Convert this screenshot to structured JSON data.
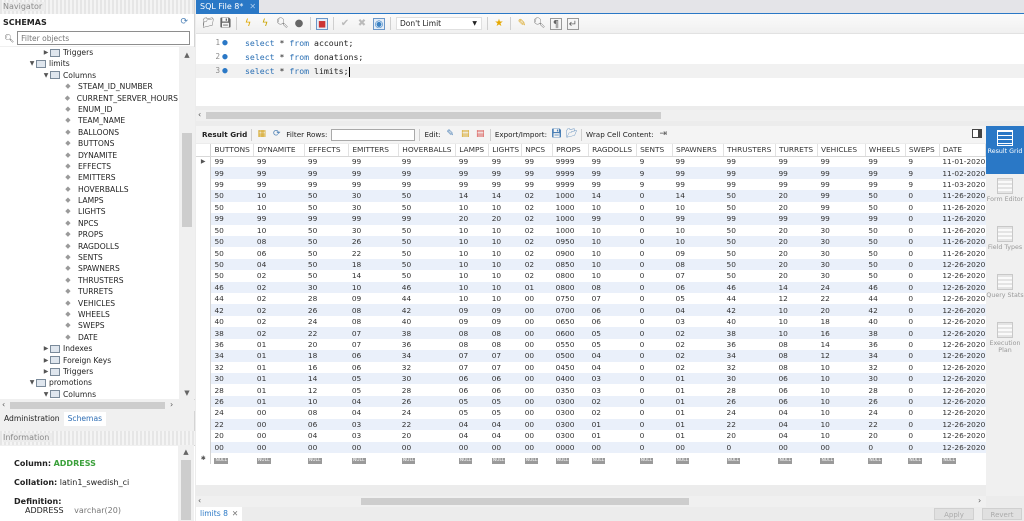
{
  "navigator": {
    "header": "Navigator",
    "schemas_title": "SCHEMAS",
    "filter_placeholder": "Filter objects",
    "tree": [
      {
        "label": "Triggers",
        "level": 3,
        "type": "folder",
        "toggle": "collapsed"
      },
      {
        "label": "limits",
        "level": 2,
        "type": "table",
        "toggle": "expanded"
      },
      {
        "label": "Columns",
        "level": 3,
        "type": "folder",
        "toggle": "expanded"
      },
      {
        "label": "STEAM_ID_NUMBER",
        "level": 4,
        "type": "column"
      },
      {
        "label": "CURRENT_SERVER_HOURS",
        "level": 4,
        "type": "column"
      },
      {
        "label": "ENUM_ID",
        "level": 4,
        "type": "column"
      },
      {
        "label": "TEAM_NAME",
        "level": 4,
        "type": "column"
      },
      {
        "label": "BALLOONS",
        "level": 4,
        "type": "column"
      },
      {
        "label": "BUTTONS",
        "level": 4,
        "type": "column"
      },
      {
        "label": "DYNAMITE",
        "level": 4,
        "type": "column"
      },
      {
        "label": "EFFECTS",
        "level": 4,
        "type": "column"
      },
      {
        "label": "EMITTERS",
        "level": 4,
        "type": "column"
      },
      {
        "label": "HOVERBALLS",
        "level": 4,
        "type": "column"
      },
      {
        "label": "LAMPS",
        "level": 4,
        "type": "column"
      },
      {
        "label": "LIGHTS",
        "level": 4,
        "type": "column"
      },
      {
        "label": "NPCS",
        "level": 4,
        "type": "column"
      },
      {
        "label": "PROPS",
        "level": 4,
        "type": "column"
      },
      {
        "label": "RAGDOLLS",
        "level": 4,
        "type": "column"
      },
      {
        "label": "SENTS",
        "level": 4,
        "type": "column"
      },
      {
        "label": "SPAWNERS",
        "level": 4,
        "type": "column"
      },
      {
        "label": "THRUSTERS",
        "level": 4,
        "type": "column"
      },
      {
        "label": "TURRETS",
        "level": 4,
        "type": "column"
      },
      {
        "label": "VEHICLES",
        "level": 4,
        "type": "column"
      },
      {
        "label": "WHEELS",
        "level": 4,
        "type": "column"
      },
      {
        "label": "SWEPS",
        "level": 4,
        "type": "column"
      },
      {
        "label": "DATE",
        "level": 4,
        "type": "column"
      },
      {
        "label": "Indexes",
        "level": 3,
        "type": "folder",
        "toggle": "collapsed"
      },
      {
        "label": "Foreign Keys",
        "level": 3,
        "type": "folder",
        "toggle": "collapsed"
      },
      {
        "label": "Triggers",
        "level": 3,
        "type": "folder",
        "toggle": "collapsed"
      },
      {
        "label": "promotions",
        "level": 2,
        "type": "table",
        "toggle": "expanded"
      },
      {
        "label": "Columns",
        "level": 3,
        "type": "folder",
        "toggle": "expanded"
      }
    ],
    "tabs": [
      "Administration",
      "Schemas"
    ],
    "active_tab": "Schemas"
  },
  "information": {
    "header": "Information",
    "column_label": "Column:",
    "column_value": "ADDRESS",
    "collation_label": "Collation:",
    "collation_value": "latin1_swedish_ci",
    "definition_label": "Definition:",
    "definition_name": "ADDRESS",
    "definition_type": "varchar(20)"
  },
  "editor": {
    "tab_title": "SQL File 8*",
    "limit_select": "Don't Limit",
    "lines": [
      {
        "num": "1",
        "kw1": "select",
        "mid": " * ",
        "kw2": "from",
        "rest": " account;"
      },
      {
        "num": "2",
        "kw1": "select",
        "mid": " * ",
        "kw2": "from",
        "rest": " donations;"
      },
      {
        "num": "3",
        "kw1": "select",
        "mid": " * ",
        "kw2": "from",
        "rest": " limits;"
      }
    ]
  },
  "result_toolbar": {
    "result_grid": "Result Grid",
    "filter_rows": "Filter Rows:",
    "edit": "Edit:",
    "export_import": "Export/Import:",
    "wrap": "Wrap Cell Content:"
  },
  "grid": {
    "columns": [
      "BUTTONS",
      "DYNAMITE",
      "EFFECTS",
      "EMITTERS",
      "HOVERBALLS",
      "LAMPS",
      "LIGHTS",
      "NPCS",
      "PROPS",
      "RAGDOLLS",
      "SENTS",
      "SPAWNERS",
      "THRUSTERS",
      "TURRETS",
      "VEHICLES",
      "WHEELS",
      "SWEPS",
      "DATE"
    ],
    "rows": [
      [
        "99",
        "99",
        "99",
        "99",
        "99",
        "99",
        "99",
        "99",
        "9999",
        "99",
        "9",
        "99",
        "99",
        "99",
        "99",
        "99",
        "9",
        "11-01-2020"
      ],
      [
        "99",
        "99",
        "99",
        "99",
        "99",
        "99",
        "99",
        "99",
        "9999",
        "99",
        "9",
        "99",
        "99",
        "99",
        "99",
        "99",
        "9",
        "11-02-2020"
      ],
      [
        "99",
        "99",
        "99",
        "99",
        "99",
        "99",
        "99",
        "99",
        "9999",
        "99",
        "9",
        "99",
        "99",
        "99",
        "99",
        "99",
        "9",
        "11-03-2020"
      ],
      [
        "50",
        "10",
        "50",
        "30",
        "50",
        "14",
        "14",
        "02",
        "1000",
        "14",
        "0",
        "14",
        "50",
        "20",
        "99",
        "50",
        "0",
        "11-26-2020"
      ],
      [
        "50",
        "10",
        "50",
        "30",
        "50",
        "10",
        "10",
        "02",
        "1000",
        "10",
        "0",
        "10",
        "50",
        "20",
        "99",
        "50",
        "0",
        "11-26-2020"
      ],
      [
        "99",
        "99",
        "99",
        "99",
        "99",
        "20",
        "20",
        "02",
        "1000",
        "99",
        "0",
        "99",
        "99",
        "99",
        "99",
        "99",
        "0",
        "11-26-2020"
      ],
      [
        "50",
        "10",
        "50",
        "30",
        "50",
        "10",
        "10",
        "02",
        "1000",
        "10",
        "0",
        "10",
        "50",
        "20",
        "30",
        "50",
        "0",
        "11-26-2020"
      ],
      [
        "50",
        "08",
        "50",
        "26",
        "50",
        "10",
        "10",
        "02",
        "0950",
        "10",
        "0",
        "10",
        "50",
        "20",
        "30",
        "50",
        "0",
        "11-26-2020"
      ],
      [
        "50",
        "06",
        "50",
        "22",
        "50",
        "10",
        "10",
        "02",
        "0900",
        "10",
        "0",
        "09",
        "50",
        "20",
        "30",
        "50",
        "0",
        "11-26-2020"
      ],
      [
        "50",
        "04",
        "50",
        "18",
        "50",
        "10",
        "10",
        "02",
        "0850",
        "10",
        "0",
        "08",
        "50",
        "20",
        "30",
        "50",
        "0",
        "12-26-2020"
      ],
      [
        "50",
        "02",
        "50",
        "14",
        "50",
        "10",
        "10",
        "02",
        "0800",
        "10",
        "0",
        "07",
        "50",
        "20",
        "30",
        "50",
        "0",
        "12-26-2020"
      ],
      [
        "46",
        "02",
        "30",
        "10",
        "46",
        "10",
        "10",
        "01",
        "0800",
        "08",
        "0",
        "06",
        "46",
        "14",
        "24",
        "46",
        "0",
        "12-26-2020"
      ],
      [
        "44",
        "02",
        "28",
        "09",
        "44",
        "10",
        "10",
        "00",
        "0750",
        "07",
        "0",
        "05",
        "44",
        "12",
        "22",
        "44",
        "0",
        "12-26-2020"
      ],
      [
        "42",
        "02",
        "26",
        "08",
        "42",
        "09",
        "09",
        "00",
        "0700",
        "06",
        "0",
        "04",
        "42",
        "10",
        "20",
        "42",
        "0",
        "12-26-2020"
      ],
      [
        "40",
        "02",
        "24",
        "08",
        "40",
        "09",
        "09",
        "00",
        "0650",
        "06",
        "0",
        "03",
        "40",
        "10",
        "18",
        "40",
        "0",
        "12-26-2020"
      ],
      [
        "38",
        "02",
        "22",
        "07",
        "38",
        "08",
        "08",
        "00",
        "0600",
        "05",
        "0",
        "02",
        "38",
        "10",
        "16",
        "38",
        "0",
        "12-26-2020"
      ],
      [
        "36",
        "01",
        "20",
        "07",
        "36",
        "08",
        "08",
        "00",
        "0550",
        "05",
        "0",
        "02",
        "36",
        "08",
        "14",
        "36",
        "0",
        "12-26-2020"
      ],
      [
        "34",
        "01",
        "18",
        "06",
        "34",
        "07",
        "07",
        "00",
        "0500",
        "04",
        "0",
        "02",
        "34",
        "08",
        "12",
        "34",
        "0",
        "12-26-2020"
      ],
      [
        "32",
        "01",
        "16",
        "06",
        "32",
        "07",
        "07",
        "00",
        "0450",
        "04",
        "0",
        "02",
        "32",
        "08",
        "10",
        "32",
        "0",
        "12-26-2020"
      ],
      [
        "30",
        "01",
        "14",
        "05",
        "30",
        "06",
        "06",
        "00",
        "0400",
        "03",
        "0",
        "01",
        "30",
        "06",
        "10",
        "30",
        "0",
        "12-26-2020"
      ],
      [
        "28",
        "01",
        "12",
        "05",
        "28",
        "06",
        "06",
        "00",
        "0350",
        "03",
        "0",
        "01",
        "28",
        "06",
        "10",
        "28",
        "0",
        "12-26-2020"
      ],
      [
        "26",
        "01",
        "10",
        "04",
        "26",
        "05",
        "05",
        "00",
        "0300",
        "02",
        "0",
        "01",
        "26",
        "06",
        "10",
        "26",
        "0",
        "12-26-2020"
      ],
      [
        "24",
        "00",
        "08",
        "04",
        "24",
        "05",
        "05",
        "00",
        "0300",
        "02",
        "0",
        "01",
        "24",
        "04",
        "10",
        "24",
        "0",
        "12-26-2020"
      ],
      [
        "22",
        "00",
        "06",
        "03",
        "22",
        "04",
        "04",
        "00",
        "0300",
        "01",
        "0",
        "01",
        "22",
        "04",
        "10",
        "22",
        "0",
        "12-26-2020"
      ],
      [
        "20",
        "00",
        "04",
        "03",
        "20",
        "04",
        "04",
        "00",
        "0300",
        "01",
        "0",
        "01",
        "20",
        "04",
        "10",
        "20",
        "0",
        "12-26-2020"
      ],
      [
        "00",
        "00",
        "00",
        "00",
        "00",
        "00",
        "00",
        "00",
        "0000",
        "00",
        "0",
        "00",
        "0",
        "00",
        "00",
        "0",
        "0",
        "12-26-2020"
      ]
    ],
    "null_label": "NULL"
  },
  "side_panel": [
    {
      "label": "Result Grid",
      "active": true
    },
    {
      "label": "Form Editor",
      "active": false
    },
    {
      "label": "Field Types",
      "active": false
    },
    {
      "label": "Query Stats",
      "active": false
    },
    {
      "label": "Execution Plan",
      "active": false
    }
  ],
  "bottom": {
    "result_tab": "limits 8",
    "apply": "Apply",
    "revert": "Revert"
  }
}
